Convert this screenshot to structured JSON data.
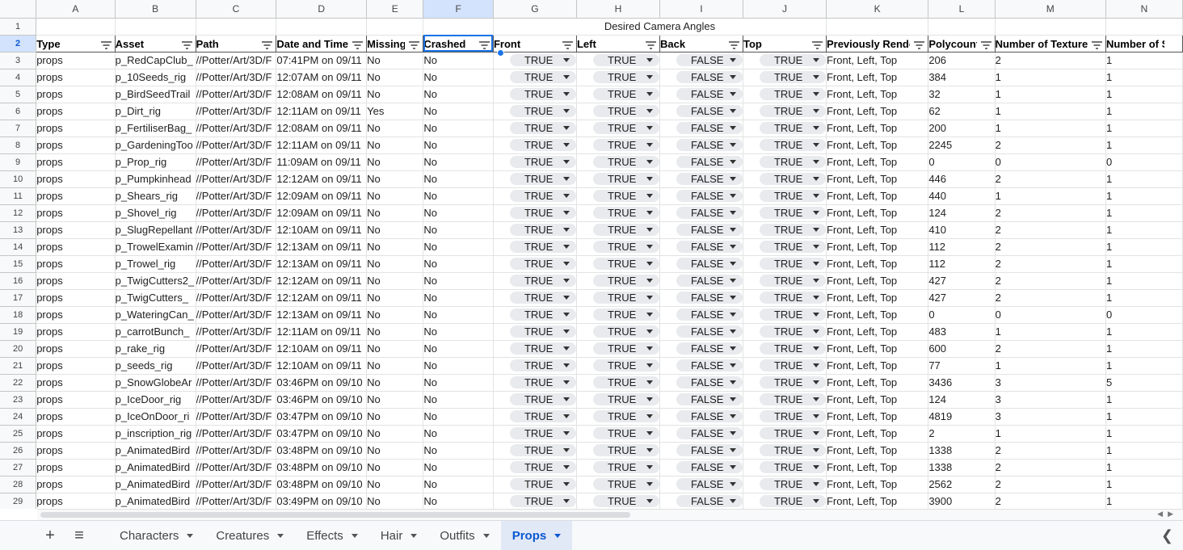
{
  "columns": [
    "A",
    "B",
    "C",
    "D",
    "E",
    "F",
    "G",
    "H",
    "I",
    "J",
    "K",
    "L",
    "M",
    "N"
  ],
  "active_column": "F",
  "merged_title": "Desired Camera Angles",
  "headers": [
    "Type",
    "Asset",
    "Path",
    "Date and Time",
    "Missing",
    "Crashed",
    "Front",
    "Left",
    "Back",
    "Top",
    "Previously Rende",
    "Polycount",
    "Number of Textures",
    "Number of Sha"
  ],
  "rows": [
    {
      "num": "3",
      "type": "props",
      "asset": "p_RedCapClub_",
      "path": "//Potter/Art/3D/F",
      "date": "07:41PM on 09/11",
      "missing": "No",
      "crashed": "No",
      "front": "TRUE",
      "left": "TRUE",
      "back": "FALSE",
      "top": "TRUE",
      "prev": "Front, Left, Top",
      "poly": "206",
      "tex": "2",
      "sha": "1"
    },
    {
      "num": "4",
      "type": "props",
      "asset": "p_10Seeds_rig",
      "path": "//Potter/Art/3D/F",
      "date": "12:07AM on 09/11",
      "missing": "No",
      "crashed": "No",
      "front": "TRUE",
      "left": "TRUE",
      "back": "FALSE",
      "top": "TRUE",
      "prev": "Front, Left, Top",
      "poly": "384",
      "tex": "1",
      "sha": "1"
    },
    {
      "num": "5",
      "type": "props",
      "asset": "p_BirdSeedTrail",
      "path": "//Potter/Art/3D/F",
      "date": "12:08AM on 09/11",
      "missing": "No",
      "crashed": "No",
      "front": "TRUE",
      "left": "TRUE",
      "back": "FALSE",
      "top": "TRUE",
      "prev": "Front, Left, Top",
      "poly": "32",
      "tex": "1",
      "sha": "1"
    },
    {
      "num": "6",
      "type": "props",
      "asset": "p_Dirt_rig",
      "path": "//Potter/Art/3D/F",
      "date": "12:11AM on 09/11",
      "missing": "Yes",
      "crashed": "No",
      "front": "TRUE",
      "left": "TRUE",
      "back": "FALSE",
      "top": "TRUE",
      "prev": "Front, Left, Top",
      "poly": "62",
      "tex": "1",
      "sha": "1"
    },
    {
      "num": "7",
      "type": "props",
      "asset": "p_FertiliserBag_",
      "path": "//Potter/Art/3D/F",
      "date": "12:08AM on 09/11",
      "missing": "No",
      "crashed": "No",
      "front": "TRUE",
      "left": "TRUE",
      "back": "FALSE",
      "top": "TRUE",
      "prev": "Front, Left, Top",
      "poly": "200",
      "tex": "1",
      "sha": "1"
    },
    {
      "num": "8",
      "type": "props",
      "asset": "p_GardeningToo",
      "path": "//Potter/Art/3D/F",
      "date": "12:11AM on 09/11",
      "missing": "No",
      "crashed": "No",
      "front": "TRUE",
      "left": "TRUE",
      "back": "FALSE",
      "top": "TRUE",
      "prev": "Front, Left, Top",
      "poly": "2245",
      "tex": "2",
      "sha": "1"
    },
    {
      "num": "9",
      "type": "props",
      "asset": "p_Prop_rig",
      "path": "//Potter/Art/3D/F",
      "date": "11:09AM on 09/11",
      "missing": "No",
      "crashed": "No",
      "front": "TRUE",
      "left": "TRUE",
      "back": "FALSE",
      "top": "TRUE",
      "prev": "Front, Left, Top",
      "poly": "0",
      "tex": "0",
      "sha": "0"
    },
    {
      "num": "10",
      "type": "props",
      "asset": "p_Pumpkinhead",
      "path": "//Potter/Art/3D/F",
      "date": "12:12AM on 09/11",
      "missing": "No",
      "crashed": "No",
      "front": "TRUE",
      "left": "TRUE",
      "back": "FALSE",
      "top": "TRUE",
      "prev": "Front, Left, Top",
      "poly": "446",
      "tex": "2",
      "sha": "1"
    },
    {
      "num": "11",
      "type": "props",
      "asset": "p_Shears_rig",
      "path": "//Potter/Art/3D/F",
      "date": "12:09AM on 09/11",
      "missing": "No",
      "crashed": "No",
      "front": "TRUE",
      "left": "TRUE",
      "back": "FALSE",
      "top": "TRUE",
      "prev": "Front, Left, Top",
      "poly": "440",
      "tex": "1",
      "sha": "1"
    },
    {
      "num": "12",
      "type": "props",
      "asset": "p_Shovel_rig",
      "path": "//Potter/Art/3D/F",
      "date": "12:09AM on 09/11",
      "missing": "No",
      "crashed": "No",
      "front": "TRUE",
      "left": "TRUE",
      "back": "FALSE",
      "top": "TRUE",
      "prev": "Front, Left, Top",
      "poly": "124",
      "tex": "2",
      "sha": "1"
    },
    {
      "num": "13",
      "type": "props",
      "asset": "p_SlugRepellant",
      "path": "//Potter/Art/3D/F",
      "date": "12:10AM on 09/11",
      "missing": "No",
      "crashed": "No",
      "front": "TRUE",
      "left": "TRUE",
      "back": "FALSE",
      "top": "TRUE",
      "prev": "Front, Left, Top",
      "poly": "410",
      "tex": "2",
      "sha": "1"
    },
    {
      "num": "14",
      "type": "props",
      "asset": "p_TrowelExamin",
      "path": "//Potter/Art/3D/F",
      "date": "12:13AM on 09/11",
      "missing": "No",
      "crashed": "No",
      "front": "TRUE",
      "left": "TRUE",
      "back": "FALSE",
      "top": "TRUE",
      "prev": "Front, Left, Top",
      "poly": "112",
      "tex": "2",
      "sha": "1"
    },
    {
      "num": "15",
      "type": "props",
      "asset": "p_Trowel_rig",
      "path": "//Potter/Art/3D/F",
      "date": "12:13AM on 09/11",
      "missing": "No",
      "crashed": "No",
      "front": "TRUE",
      "left": "TRUE",
      "back": "FALSE",
      "top": "TRUE",
      "prev": "Front, Left, Top",
      "poly": "112",
      "tex": "2",
      "sha": "1"
    },
    {
      "num": "16",
      "type": "props",
      "asset": "p_TwigCutters2_",
      "path": "//Potter/Art/3D/F",
      "date": "12:12AM on 09/11",
      "missing": "No",
      "crashed": "No",
      "front": "TRUE",
      "left": "TRUE",
      "back": "FALSE",
      "top": "TRUE",
      "prev": "Front, Left, Top",
      "poly": "427",
      "tex": "2",
      "sha": "1"
    },
    {
      "num": "17",
      "type": "props",
      "asset": "p_TwigCutters_",
      "path": "//Potter/Art/3D/F",
      "date": "12:12AM on 09/11",
      "missing": "No",
      "crashed": "No",
      "front": "TRUE",
      "left": "TRUE",
      "back": "FALSE",
      "top": "TRUE",
      "prev": "Front, Left, Top",
      "poly": "427",
      "tex": "2",
      "sha": "1"
    },
    {
      "num": "18",
      "type": "props",
      "asset": "p_WateringCan_",
      "path": "//Potter/Art/3D/F",
      "date": "12:13AM on 09/11",
      "missing": "No",
      "crashed": "No",
      "front": "TRUE",
      "left": "TRUE",
      "back": "FALSE",
      "top": "TRUE",
      "prev": "Front, Left, Top",
      "poly": "0",
      "tex": "0",
      "sha": "0"
    },
    {
      "num": "19",
      "type": "props",
      "asset": "p_carrotBunch_",
      "path": "//Potter/Art/3D/F",
      "date": "12:11AM on 09/11",
      "missing": "No",
      "crashed": "No",
      "front": "TRUE",
      "left": "TRUE",
      "back": "FALSE",
      "top": "TRUE",
      "prev": "Front, Left, Top",
      "poly": "483",
      "tex": "1",
      "sha": "1"
    },
    {
      "num": "20",
      "type": "props",
      "asset": "p_rake_rig",
      "path": "//Potter/Art/3D/F",
      "date": "12:10AM on 09/11",
      "missing": "No",
      "crashed": "No",
      "front": "TRUE",
      "left": "TRUE",
      "back": "FALSE",
      "top": "TRUE",
      "prev": "Front, Left, Top",
      "poly": "600",
      "tex": "2",
      "sha": "1"
    },
    {
      "num": "21",
      "type": "props",
      "asset": "p_seeds_rig",
      "path": "//Potter/Art/3D/F",
      "date": "12:10AM on 09/11",
      "missing": "No",
      "crashed": "No",
      "front": "TRUE",
      "left": "TRUE",
      "back": "FALSE",
      "top": "TRUE",
      "prev": "Front, Left, Top",
      "poly": "77",
      "tex": "1",
      "sha": "1"
    },
    {
      "num": "22",
      "type": "props",
      "asset": "p_SnowGlobeAr",
      "path": "//Potter/Art/3D/F",
      "date": "03:46PM on 09/10",
      "missing": "No",
      "crashed": "No",
      "front": "TRUE",
      "left": "TRUE",
      "back": "FALSE",
      "top": "TRUE",
      "prev": "Front, Left, Top",
      "poly": "3436",
      "tex": "3",
      "sha": "5"
    },
    {
      "num": "23",
      "type": "props",
      "asset": "p_IceDoor_rig",
      "path": "//Potter/Art/3D/F",
      "date": "03:46PM on 09/10",
      "missing": "No",
      "crashed": "No",
      "front": "TRUE",
      "left": "TRUE",
      "back": "FALSE",
      "top": "TRUE",
      "prev": "Front, Left, Top",
      "poly": "124",
      "tex": "3",
      "sha": "1"
    },
    {
      "num": "24",
      "type": "props",
      "asset": "p_IceOnDoor_ri",
      "path": "//Potter/Art/3D/F",
      "date": "03:47PM on 09/10",
      "missing": "No",
      "crashed": "No",
      "front": "TRUE",
      "left": "TRUE",
      "back": "FALSE",
      "top": "TRUE",
      "prev": "Front, Left, Top",
      "poly": "4819",
      "tex": "3",
      "sha": "1"
    },
    {
      "num": "25",
      "type": "props",
      "asset": "p_inscription_rig",
      "path": "//Potter/Art/3D/F",
      "date": "03:47PM on 09/10",
      "missing": "No",
      "crashed": "No",
      "front": "TRUE",
      "left": "TRUE",
      "back": "FALSE",
      "top": "TRUE",
      "prev": "Front, Left, Top",
      "poly": "2",
      "tex": "1",
      "sha": "1"
    },
    {
      "num": "26",
      "type": "props",
      "asset": "p_AnimatedBird",
      "path": "//Potter/Art/3D/F",
      "date": "03:48PM on 09/10",
      "missing": "No",
      "crashed": "No",
      "front": "TRUE",
      "left": "TRUE",
      "back": "FALSE",
      "top": "TRUE",
      "prev": "Front, Left, Top",
      "poly": "1338",
      "tex": "2",
      "sha": "1"
    },
    {
      "num": "27",
      "type": "props",
      "asset": "p_AnimatedBird",
      "path": "//Potter/Art/3D/F",
      "date": "03:48PM on 09/10",
      "missing": "No",
      "crashed": "No",
      "front": "TRUE",
      "left": "TRUE",
      "back": "FALSE",
      "top": "TRUE",
      "prev": "Front, Left, Top",
      "poly": "1338",
      "tex": "2",
      "sha": "1"
    },
    {
      "num": "28",
      "type": "props",
      "asset": "p_AnimatedBird",
      "path": "//Potter/Art/3D/F",
      "date": "03:48PM on 09/10",
      "missing": "No",
      "crashed": "No",
      "front": "TRUE",
      "left": "TRUE",
      "back": "FALSE",
      "top": "TRUE",
      "prev": "Front, Left, Top",
      "poly": "2562",
      "tex": "2",
      "sha": "1"
    },
    {
      "num": "29",
      "type": "props",
      "asset": "p_AnimatedBird",
      "path": "//Potter/Art/3D/F",
      "date": "03:49PM on 09/10",
      "missing": "No",
      "crashed": "No",
      "front": "TRUE",
      "left": "TRUE",
      "back": "FALSE",
      "top": "TRUE",
      "prev": "Front, Left, Top",
      "poly": "3900",
      "tex": "2",
      "sha": "1"
    }
  ],
  "sheet_tabs": [
    "Characters",
    "Creatures",
    "Effects",
    "Hair",
    "Outfits",
    "Props"
  ],
  "active_sheet": "Props",
  "colors": {
    "accent": "#1a73e8",
    "active_tab_bg": "#e1e9f7",
    "active_tab_text": "#0b57d0"
  }
}
